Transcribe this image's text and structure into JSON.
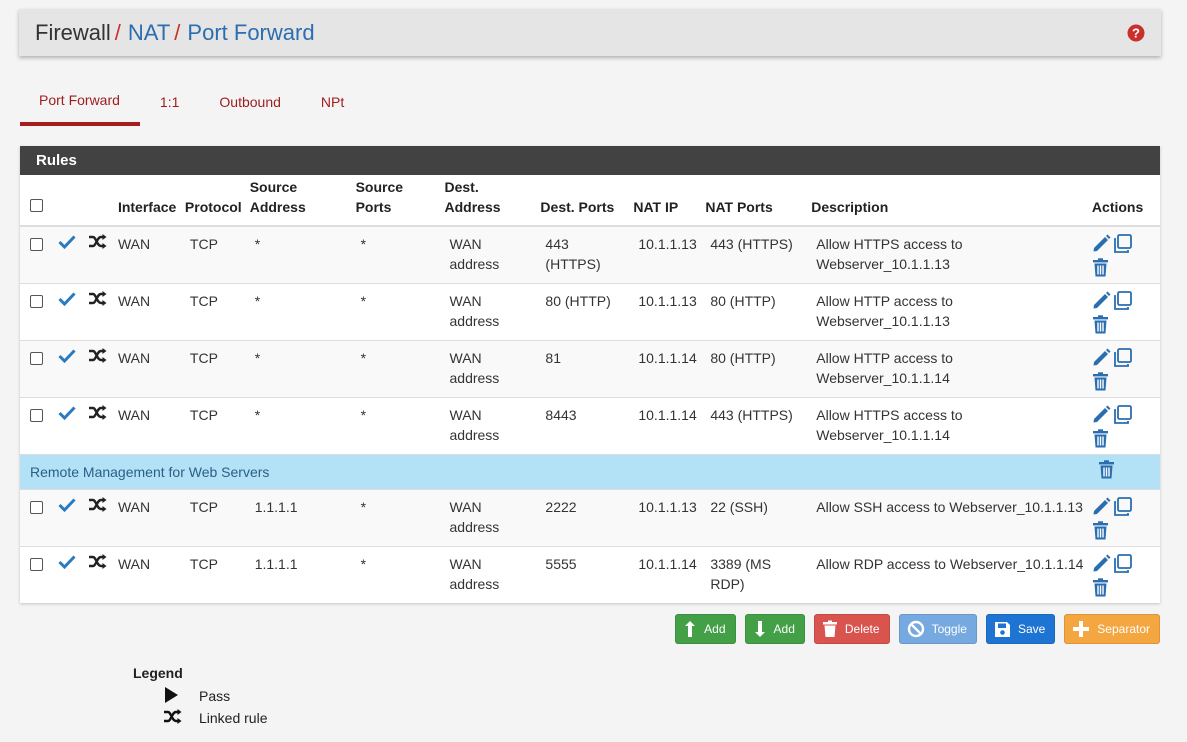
{
  "breadcrumb": {
    "items": [
      "Firewall",
      "NAT",
      "Port Forward"
    ],
    "separator": "/"
  },
  "tabs": [
    "Port Forward",
    "1:1",
    "Outbound",
    "NPt"
  ],
  "panel": {
    "title": "Rules",
    "columns": {
      "interface": "Interface",
      "protocol": "Protocol",
      "source_address": [
        "Source",
        "Address"
      ],
      "source_ports": [
        "Source",
        "Ports"
      ],
      "dest_address": [
        "Dest.",
        "Address"
      ],
      "dest_ports": "Dest. Ports",
      "nat_ip": "NAT IP",
      "nat_ports": "NAT Ports",
      "description": "Description",
      "actions": "Actions"
    },
    "rules": [
      {
        "interface": "WAN",
        "protocol": "TCP",
        "source_address": "*",
        "source_ports": "*",
        "dest_address": [
          "WAN",
          "address"
        ],
        "dest_ports": [
          "443",
          "(HTTPS)"
        ],
        "nat_ip": "10.1.1.13",
        "nat_ports": [
          "443 (HTTPS)",
          ""
        ],
        "description": [
          "Allow HTTPS access to",
          "Webserver_10.1.1.13"
        ]
      },
      {
        "interface": "WAN",
        "protocol": "TCP",
        "source_address": "*",
        "source_ports": "*",
        "dest_address": [
          "WAN",
          "address"
        ],
        "dest_ports": [
          "80 (HTTP)",
          ""
        ],
        "nat_ip": "10.1.1.13",
        "nat_ports": [
          "80 (HTTP)",
          ""
        ],
        "description": [
          "Allow HTTP access to",
          "Webserver_10.1.1.13"
        ]
      },
      {
        "interface": "WAN",
        "protocol": "TCP",
        "source_address": "*",
        "source_ports": "*",
        "dest_address": [
          "WAN",
          "address"
        ],
        "dest_ports": [
          "81",
          ""
        ],
        "nat_ip": "10.1.1.14",
        "nat_ports": [
          "80 (HTTP)",
          ""
        ],
        "description": [
          "Allow HTTP access to",
          "Webserver_10.1.1.14"
        ]
      },
      {
        "interface": "WAN",
        "protocol": "TCP",
        "source_address": "*",
        "source_ports": "*",
        "dest_address": [
          "WAN",
          "address"
        ],
        "dest_ports": [
          "8443",
          ""
        ],
        "nat_ip": "10.1.1.14",
        "nat_ports": [
          "443 (HTTPS)",
          ""
        ],
        "description": [
          "Allow HTTPS access to",
          "Webserver_10.1.1.14"
        ]
      }
    ],
    "separator_label": "Remote Management for Web Servers",
    "rules_after": [
      {
        "interface": "WAN",
        "protocol": "TCP",
        "source_address": "1.1.1.1",
        "source_ports": "*",
        "dest_address": [
          "WAN",
          "address"
        ],
        "dest_ports": [
          "2222",
          ""
        ],
        "nat_ip": "10.1.1.13",
        "nat_ports": [
          "22 (SSH)",
          ""
        ],
        "description": [
          "Allow SSH access to Webserver_10.1.1.13",
          ""
        ]
      },
      {
        "interface": "WAN",
        "protocol": "TCP",
        "source_address": "1.1.1.1",
        "source_ports": "*",
        "dest_address": [
          "WAN",
          "address"
        ],
        "dest_ports": [
          "5555",
          ""
        ],
        "nat_ip": "10.1.1.14",
        "nat_ports": [
          "3389 (MS",
          "RDP)"
        ],
        "description": [
          "Allow RDP access to Webserver_10.1.1.14",
          ""
        ]
      }
    ]
  },
  "buttons": {
    "add_top": "Add",
    "add_bottom": "Add",
    "delete": "Delete",
    "toggle": "Toggle",
    "save": "Save",
    "separator": "Separator"
  },
  "legend": {
    "title": "Legend",
    "pass": "Pass",
    "linked": "Linked rule"
  },
  "colors": {
    "accent_red": "#a51d1d",
    "link_blue": "#2a6eb0",
    "check_blue": "#2a7ac0",
    "separator_bg": "#b3e1f5"
  },
  "icons": {
    "help": "question-circle-icon",
    "enabled": "check-icon",
    "linked": "shuffle-icon",
    "edit": "pencil-icon",
    "copy": "copy-icon",
    "delete": "trash-icon",
    "pass": "play-icon"
  }
}
